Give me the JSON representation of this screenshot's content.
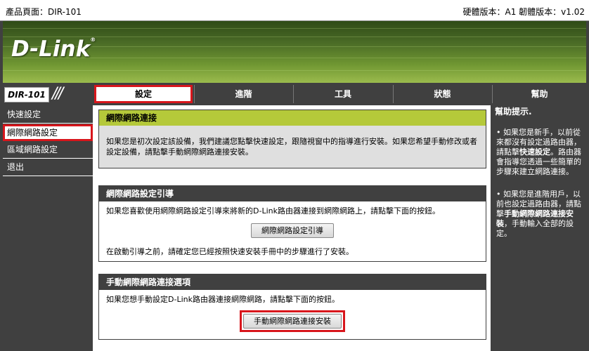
{
  "topbar": {
    "product": "產品頁面：DIR-101",
    "versions": "硬體版本：A1  韌體版本：v1.02"
  },
  "banner": {
    "logo": "D-Link",
    "reg": "®"
  },
  "nav": {
    "model": "DIR-101",
    "slashes": "///",
    "tabs": [
      {
        "label": "設定",
        "active": true
      },
      {
        "label": "進階"
      },
      {
        "label": "工具"
      },
      {
        "label": "狀態"
      },
      {
        "label": "幫助"
      }
    ]
  },
  "sidebar": {
    "items": [
      {
        "label": "快速設定"
      },
      {
        "label": "網際網路設定",
        "active": true
      },
      {
        "label": "區域網路設定"
      },
      {
        "label": "退出"
      }
    ]
  },
  "main": {
    "box1": {
      "title": "網際網路連接",
      "text": "如果您是初次設定該設備，我們建議您點擊快速設定，跟隨視窗中的指導進行安裝。如果您希望手動修改或者設定設備，請點擊手動網際網路連接安裝。"
    },
    "box2": {
      "title": "網際網路設定引導",
      "text": "如果您喜歡使用網際網路設定引導來將新的D-Link路由器連接到網際網路上，請點擊下面的按鈕。",
      "button": "網際網路設定引導",
      "note": "在啟動引導之前，請確定您已經按照快速安裝手冊中的步驟進行了安裝。"
    },
    "box3": {
      "title": "手動網際網路連接選項",
      "text": "如果您想手動設定D-Link路由器連接網際網路，請點擊下面的按鈕。",
      "button": "手動網際網路連接安裝"
    }
  },
  "help": {
    "title": "幫助提示.",
    "p1_a": "• 如果您是新手，以前從來都沒有設定過路由器，請點擊",
    "p1_b": "快速設定",
    "p1_c": "。路由器會指導您透過一些簡單的步驟來建立網路連接。",
    "p2_a": "• 如果您是進階用戶，以前也設定過路由器，請點擊",
    "p2_b": "手動網際網路連接安裝",
    "p2_c": "，手動輸入全部的設定。"
  },
  "colors": {
    "highlight": "#d8161c",
    "panel": "#404040",
    "header_green": "#b5c93a"
  }
}
